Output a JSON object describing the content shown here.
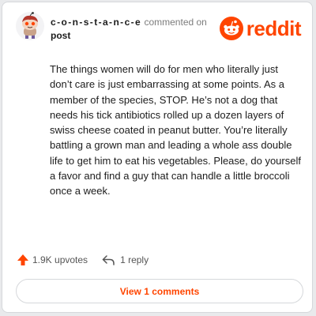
{
  "comment": {
    "author": "c-o-n-s-t-a-n-c-e",
    "action": "commented on",
    "target": "post",
    "body": "The things women will do for men who literally just don’t care is just embarrassing at some points. As a member of the species, STOP. He’s not a dog that needs his tick antibiotics rolled up a dozen layers of swiss cheese coated in peanut butter. You’re literally battling a grown man and leading a whole ass double life to get him to eat his vegetables. Please, do yourself a favor and find a guy that can handle a little broccoli once a week.",
    "upvotes": "1.9K upvotes",
    "replies": "1 reply",
    "view_comments": "View 1 comments"
  },
  "brand": {
    "name": "reddit",
    "color": "#ff4500"
  },
  "icons": {
    "avatar": "snoo-avatar-icon",
    "logo": "reddit-logo-icon",
    "upvote": "upvote-arrow-icon",
    "reply": "reply-arrow-icon"
  }
}
